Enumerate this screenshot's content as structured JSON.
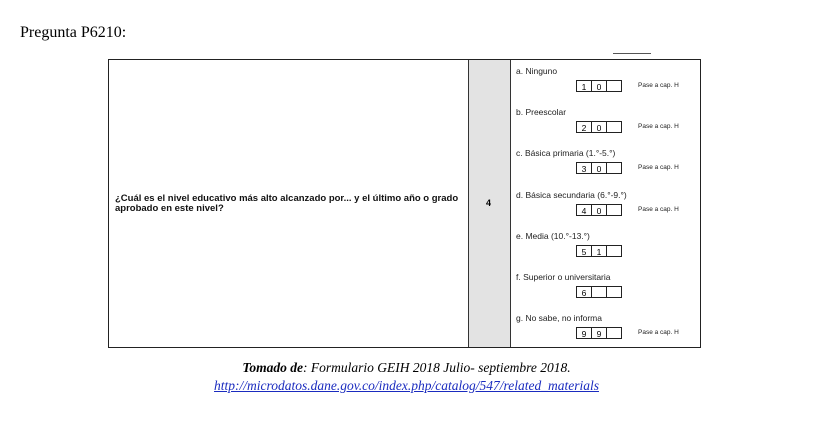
{
  "heading": "Pregunta P6210:",
  "question": "¿Cuál es el nivel educativo más alto alcanzado por... y el último año o grado aprobado en este nivel?",
  "question_number": "4",
  "options": [
    {
      "label": "a.  Ninguno",
      "codes": [
        "1",
        "0",
        ""
      ],
      "note": "Pase a cap. H"
    },
    {
      "label": "b.  Preescolar",
      "codes": [
        "2",
        "0",
        ""
      ],
      "note": "Pase a cap. H"
    },
    {
      "label": "c.  Básica primaria (1.°-5.°)",
      "codes": [
        "3",
        "0",
        ""
      ],
      "note": "Pase a cap. H"
    },
    {
      "label": "d.  Básica secundaria (6.°-9.°)",
      "codes": [
        "4",
        "0",
        ""
      ],
      "note": "Pase a cap. H"
    },
    {
      "label": "e.  Media (10.°-13.°)",
      "codes": [
        "5",
        "1",
        ""
      ],
      "note": ""
    },
    {
      "label": "f.  Superior o universitaria",
      "codes": [
        "6",
        "",
        ""
      ],
      "note": ""
    },
    {
      "label": "g.  No sabe, no informa",
      "codes": [
        "9",
        "9",
        ""
      ],
      "note": "Pase a cap. H"
    }
  ],
  "caption": {
    "prefix": "Tomado de",
    "text": ": Formulario GEIH 2018 Julio- septiembre 2018."
  },
  "link": "http://microdatos.dane.gov.co/index.php/catalog/547/related_materials"
}
